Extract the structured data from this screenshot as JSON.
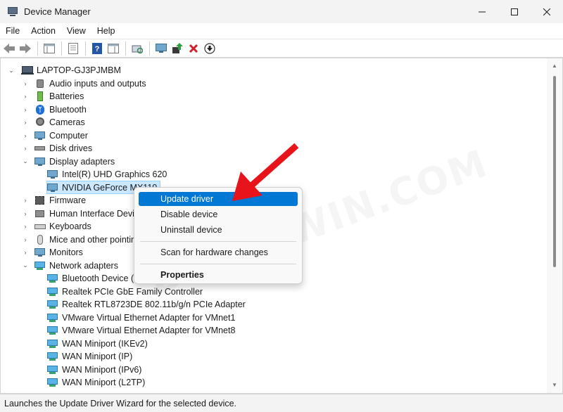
{
  "window": {
    "title": "Device Manager"
  },
  "menu": {
    "file": "File",
    "action": "Action",
    "view": "View",
    "help": "Help"
  },
  "toolbar_icons": [
    "back-arrow-icon",
    "forward-arrow-icon",
    "properties-icon",
    "console-tree-icon",
    "help-icon",
    "action-pane-icon",
    "scan-hardware-icon",
    "monitor-icon",
    "update-driver-icon",
    "uninstall-icon",
    "download-icon"
  ],
  "tree": {
    "root": "LAPTOP-GJ3PJMBM",
    "categories": {
      "audio": "Audio inputs and outputs",
      "batteries": "Batteries",
      "bluetooth": "Bluetooth",
      "cameras": "Cameras",
      "computer": "Computer",
      "disk_drives": "Disk drives",
      "display_adapters": "Display adapters",
      "firmware": "Firmware",
      "hid": "Human Interface Devic",
      "keyboards": "Keyboards",
      "mice": "Mice and other pointin",
      "monitors": "Monitors",
      "network_adapters": "Network adapters"
    },
    "display_children": [
      "Intel(R) UHD Graphics 620",
      "NVIDIA GeForce MX110"
    ],
    "network_children": [
      "Bluetooth Device (",
      "Realtek PCIe GbE Family Controller",
      "Realtek RTL8723DE 802.11b/g/n PCIe Adapter",
      "VMware Virtual Ethernet Adapter for VMnet1",
      "VMware Virtual Ethernet Adapter for VMnet8",
      "WAN Miniport (IKEv2)",
      "WAN Miniport (IP)",
      "WAN Miniport (IPv6)",
      "WAN Miniport (L2TP)"
    ]
  },
  "context_menu": {
    "update_driver": "Update driver",
    "disable_device": "Disable device",
    "uninstall_device": "Uninstall device",
    "scan_hardware": "Scan for hardware changes",
    "properties": "Properties"
  },
  "watermark": "DROIDWIN.COM",
  "status": {
    "text": "Launches the Update Driver Wizard for the selected device."
  },
  "colors": {
    "highlight": "#0078d4",
    "selection": "#cce8ff",
    "arrow": "#e8141c"
  }
}
